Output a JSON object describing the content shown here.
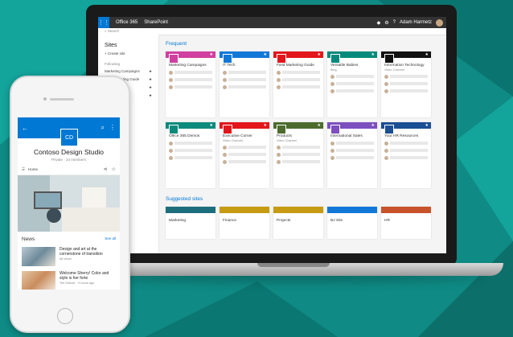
{
  "laptop": {
    "suite_bar": {
      "waffle_icon": "waffle-icon",
      "app_name": "Office 365",
      "site_name": "SharePoint",
      "user_name": "Adam Harmetz"
    },
    "search": {
      "placeholder": "Search"
    },
    "left_nav": {
      "title": "Sites",
      "create_label": "+ Create site",
      "following_label": "Following",
      "items": [
        "Marketing Campaigns",
        "Paid Marketing Guide",
        "Final...",
        "",
        "Development",
        "",
        "",
        ""
      ]
    },
    "frequent_title": "Frequent",
    "frequent_sites": [
      {
        "name": "Marketing Campaigns",
        "color": "#d13fa0"
      },
      {
        "name": "IT Tech",
        "color": "#1278d8"
      },
      {
        "name": "Field Marketing Guide",
        "color": "#e3161b"
      },
      {
        "name": "Versatile Babies",
        "sub": "Blog",
        "color": "#078a7c"
      },
      {
        "name": "Information Technology",
        "sub": "Video Channel",
        "color": "#111111"
      },
      {
        "name": "Office 365 Demos",
        "color": "#0c8a7b"
      },
      {
        "name": "Executive Corner",
        "sub": "Video Channel",
        "color": "#e3161b"
      },
      {
        "name": "Products",
        "sub": "Video Channel",
        "color": "#4c6b2c"
      },
      {
        "name": "International Sales",
        "color": "#7c4fbf"
      },
      {
        "name": "Your HR Resources",
        "color": "#1b4e93"
      }
    ],
    "suggested_title": "Suggested sites",
    "suggested_sites": [
      {
        "name": "Marketing",
        "color": "#1d6e7c"
      },
      {
        "name": "Finance",
        "color": "#c69b12"
      },
      {
        "name": "Projects",
        "color": "#c69b12"
      },
      {
        "name": "BJ Site",
        "color": "#1278d8"
      },
      {
        "name": "HR",
        "color": "#c8532b"
      }
    ]
  },
  "phone": {
    "back_icon": "back-arrow-icon",
    "logo_text": "CD",
    "site_title": "Contoso Design Studio",
    "site_sub": "Private  ·  24 members",
    "home_label": "Home",
    "news_title": "News",
    "see_all": "See all",
    "news": [
      {
        "title": "Design and art at the cornerstone of transition",
        "meta": "86 views"
      },
      {
        "title": "Welcome Sherry! Color and style is her forte",
        "meta": "Tim Deboer · 3 hours ago"
      }
    ]
  }
}
